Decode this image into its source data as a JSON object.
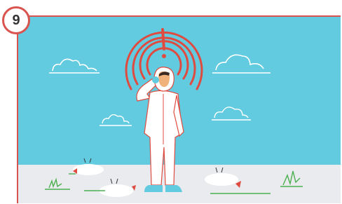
{
  "step_badge": {
    "number": "9"
  },
  "colors": {
    "frame": "#d9534f",
    "sky": "#62cbe0",
    "ground": "#e9ebee",
    "alarm": "#e04b40",
    "grass": "#4caf50"
  },
  "icons": [
    "alarm-signal-icon",
    "cloud-icon",
    "dead-chicken-icon",
    "grass-icon",
    "person-in-protective-suit-icon"
  ]
}
